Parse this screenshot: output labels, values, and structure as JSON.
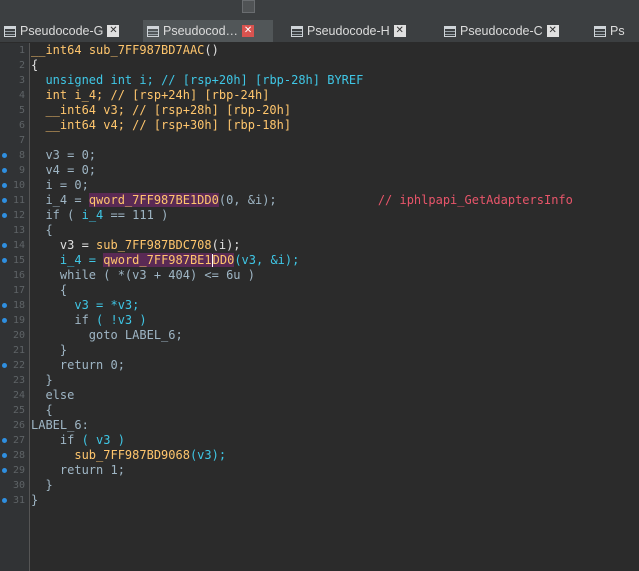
{
  "tabs": [
    {
      "label": "Pseudocode-G",
      "active": false
    },
    {
      "label": "Pseudocod…",
      "active": true
    },
    {
      "label": "Pseudocode-H",
      "active": false
    },
    {
      "label": "Pseudocode-C",
      "active": false
    },
    {
      "label": "Ps",
      "active": false
    }
  ],
  "code": {
    "l1": {
      "ty": "__int64",
      "fn": "sub_7FF987BD7AAC",
      "rest": "()"
    },
    "l2": "{",
    "l3": {
      "kw": "unsigned int",
      "id": " i;",
      "cm": " // [rsp+20h] [rbp-28h] BYREF"
    },
    "l4": {
      "kw": "int",
      "id": " i_4;",
      "cm": " // [rsp+24h] [rbp-24h]"
    },
    "l5": {
      "ty": "__int64",
      "id": " v3;",
      "cm": " // [rsp+28h] [rbp-20h]"
    },
    "l6": {
      "ty": "__int64",
      "id": " v4;",
      "cm": " // [rsp+30h] [rbp-18h]"
    },
    "l7": "",
    "l8": "v3 = 0;",
    "l9": "v4 = 0;",
    "l10": "i = 0;",
    "l11": {
      "pre": "i_4 = ",
      "fn": "qword_7FF987BE1DD0",
      "post": "(0, &i);",
      "cm": "// iphlpapi_GetAdaptersInfo"
    },
    "l12": {
      "kw": "if",
      "pre": " ( ",
      "id": "i_4",
      "post": " == 111 )"
    },
    "l13": "{",
    "l14": {
      "pre": "v3 = ",
      "fn": "sub_7FF987BDC708",
      "post": "(i);"
    },
    "l15": {
      "pre": "i_4 = ",
      "fn_a": "qword_7FF987BE1",
      "fn_b": "DD0",
      "post": "(v3, &i);"
    },
    "l16": {
      "kw": "while",
      "post": " ( *(v3 + 404) <= 6u )"
    },
    "l17": "{",
    "l18": "v3 = *v3;",
    "l19": {
      "kw": "if",
      "post": " ( !v3 )"
    },
    "l20": {
      "kw": "goto",
      "post": " LABEL_6;"
    },
    "l21": "}",
    "l22": {
      "kw": "return",
      "post": " 0;"
    },
    "l23": "}",
    "l24": "else",
    "l25": "{",
    "l26": "LABEL_6:",
    "l27": {
      "kw": "if",
      "post": " ( v3 )"
    },
    "l28": {
      "fn": "sub_7FF987BD9068",
      "post": "(v3);"
    },
    "l29": {
      "kw": "return",
      "post": " 1;"
    },
    "l30": "}",
    "l31": "}"
  },
  "line_numbers": [
    "1",
    "2",
    "3",
    "4",
    "5",
    "6",
    "7",
    "8",
    "9",
    "10",
    "11",
    "12",
    "13",
    "14",
    "15",
    "16",
    "17",
    "18",
    "19",
    "20",
    "21",
    "22",
    "23",
    "24",
    "25",
    "26",
    "27",
    "28",
    "29",
    "30",
    "31"
  ],
  "colors": {
    "accent": "#2f8fe0",
    "close_active": "#d9534f",
    "highlight": "#5a2a55"
  },
  "icons": {
    "tab": "pseudocode-icon",
    "close": "close-icon"
  }
}
